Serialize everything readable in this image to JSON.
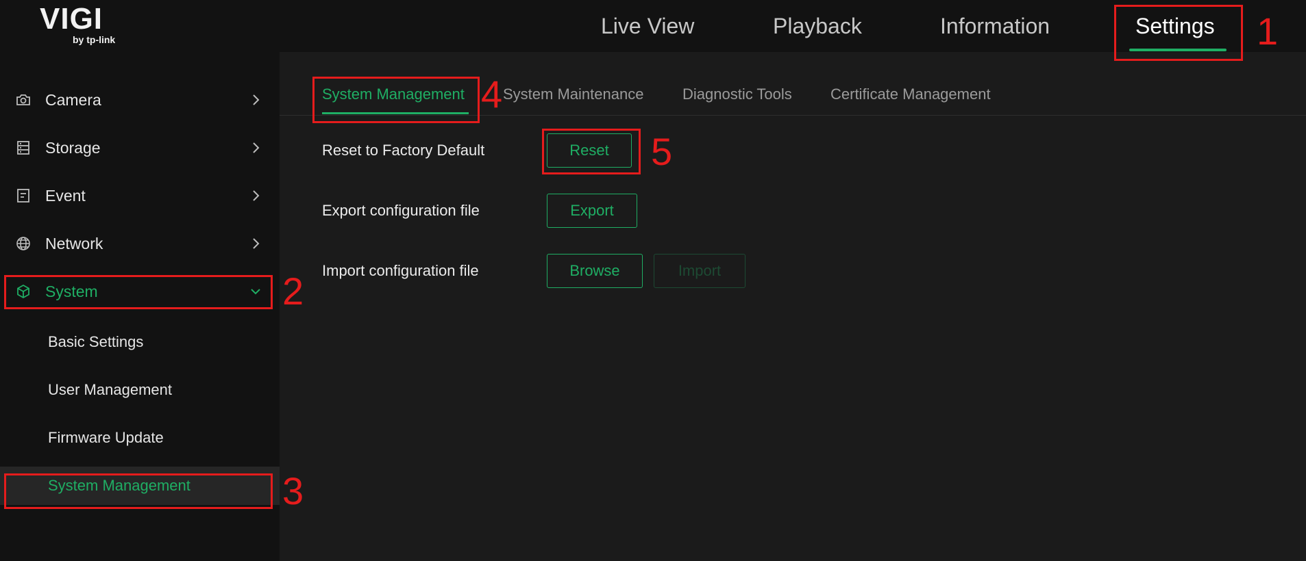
{
  "brand": {
    "logo_main": "VIGI",
    "logo_sub": "by tp-link"
  },
  "topnav": {
    "items": [
      {
        "label": "Live View"
      },
      {
        "label": "Playback"
      },
      {
        "label": "Information"
      },
      {
        "label": "Settings",
        "active": true
      }
    ]
  },
  "sidebar": {
    "items": [
      {
        "label": "Camera",
        "icon": "camera-icon"
      },
      {
        "label": "Storage",
        "icon": "storage-icon"
      },
      {
        "label": "Event",
        "icon": "event-icon"
      },
      {
        "label": "Network",
        "icon": "globe-icon"
      },
      {
        "label": "System",
        "icon": "cube-icon",
        "active": true,
        "expanded": true
      }
    ],
    "subitems": [
      {
        "label": "Basic Settings"
      },
      {
        "label": "User Management"
      },
      {
        "label": "Firmware Update"
      },
      {
        "label": "System Management",
        "active": true
      }
    ]
  },
  "tabs": [
    {
      "label": "System Management",
      "active": true
    },
    {
      "label": "System Maintenance"
    },
    {
      "label": "Diagnostic Tools"
    },
    {
      "label": "Certificate Management"
    }
  ],
  "rows": {
    "reset": {
      "label": "Reset to Factory Default",
      "button": "Reset"
    },
    "export": {
      "label": "Export configuration file",
      "button": "Export"
    },
    "import": {
      "label": "Import configuration file",
      "browse_button": "Browse",
      "import_button": "Import"
    }
  },
  "annotations": [
    "1",
    "2",
    "3",
    "4",
    "5"
  ],
  "colors": {
    "accent": "#1fae64",
    "annotation": "#e51c1c",
    "background": "#1b1b1b",
    "sidebar": "#121212"
  }
}
